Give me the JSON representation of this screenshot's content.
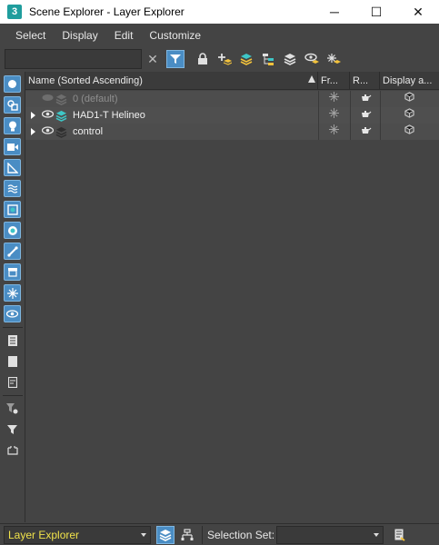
{
  "window": {
    "app_icon": "3",
    "title": "Scene Explorer - Layer Explorer",
    "minimize": "─",
    "maximize": "☐",
    "close": "✕"
  },
  "menu": [
    "Select",
    "Display",
    "Edit",
    "Customize"
  ],
  "toolbar": {
    "search_value": "",
    "clear_icon": "✕",
    "icons": [
      "filter-icon",
      "lock-icon",
      "add-layer-icon",
      "layer-stack-icon",
      "hierarchy-icon",
      "layers-icon",
      "eye-layer-icon",
      "freeze-layer-icon"
    ]
  },
  "left_tools": [
    "geometry-icon",
    "shapes-icon",
    "lights-icon",
    "cameras-icon",
    "helpers-icon",
    "space-warps-icon",
    "groups-icon",
    "xrefs-icon",
    "bones-icon",
    "containers-icon",
    "frozen-icon",
    "hidden-icon",
    "list-all-icon",
    "list-none-icon",
    "invert-icon",
    "filter-options-icon",
    "filter-icon",
    "select-children-icon"
  ],
  "table": {
    "columns": [
      "Name (Sorted Ascending)",
      "Fr...",
      "R...",
      "Display a..."
    ],
    "rows": [
      {
        "name": "0 (default)",
        "dim": true,
        "expandable": false
      },
      {
        "name": "HAD1-T Helineo",
        "dim": false,
        "expandable": true
      },
      {
        "name": "control",
        "dim": false,
        "expandable": true
      }
    ]
  },
  "bottom": {
    "explorer_label": "Layer Explorer",
    "selection_set_label": "Selection Set:",
    "selection_set_value": ""
  },
  "colors": {
    "accent_blue": "#4a8dc4",
    "layer_teal": "#3ec6c6",
    "explorer_label_yellow": "#f0e24a"
  }
}
